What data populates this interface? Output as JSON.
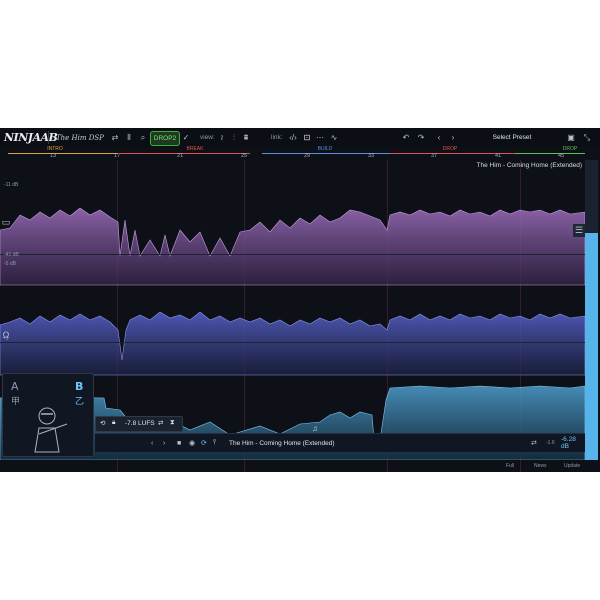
{
  "brand": {
    "logo": "NINJAAB",
    "partner": "The Him DSP"
  },
  "toolbar": {
    "drop_badge": "DROP2",
    "view_label": "view:",
    "link_label": "link:",
    "preset_label": "Select Preset"
  },
  "timeline": {
    "sections": [
      "INTRO",
      "BREAK",
      "BUILD",
      "DROP",
      "DROP"
    ],
    "bars": [
      "13",
      "17",
      "21",
      "25",
      "29",
      "33",
      "37",
      "41",
      "45"
    ]
  },
  "track": {
    "title": "The Him - Coming Home (Extended)"
  },
  "levels": {
    "top": "-11 dB",
    "mid": "-41 dB",
    "mid2": "-5 dB",
    "low": "-1"
  },
  "ab": {
    "a": "A",
    "b": "B",
    "a_kanji": "甲",
    "b_kanji": "乙"
  },
  "lufs": {
    "value": "-7.8 LUFS"
  },
  "player": {
    "title": "The Him - Coming Home (Extended)",
    "gain": "-6.28 dB",
    "gain_small": "-1.6"
  },
  "footer": {
    "tabs": [
      "Full",
      "News",
      "Update"
    ]
  },
  "colors": {
    "lane1": "#8a5aa8",
    "lane2": "#4a52a8",
    "lane3": "#3c86b6",
    "accent": "#56b4ea",
    "drop_badge": "#3fae3f"
  }
}
